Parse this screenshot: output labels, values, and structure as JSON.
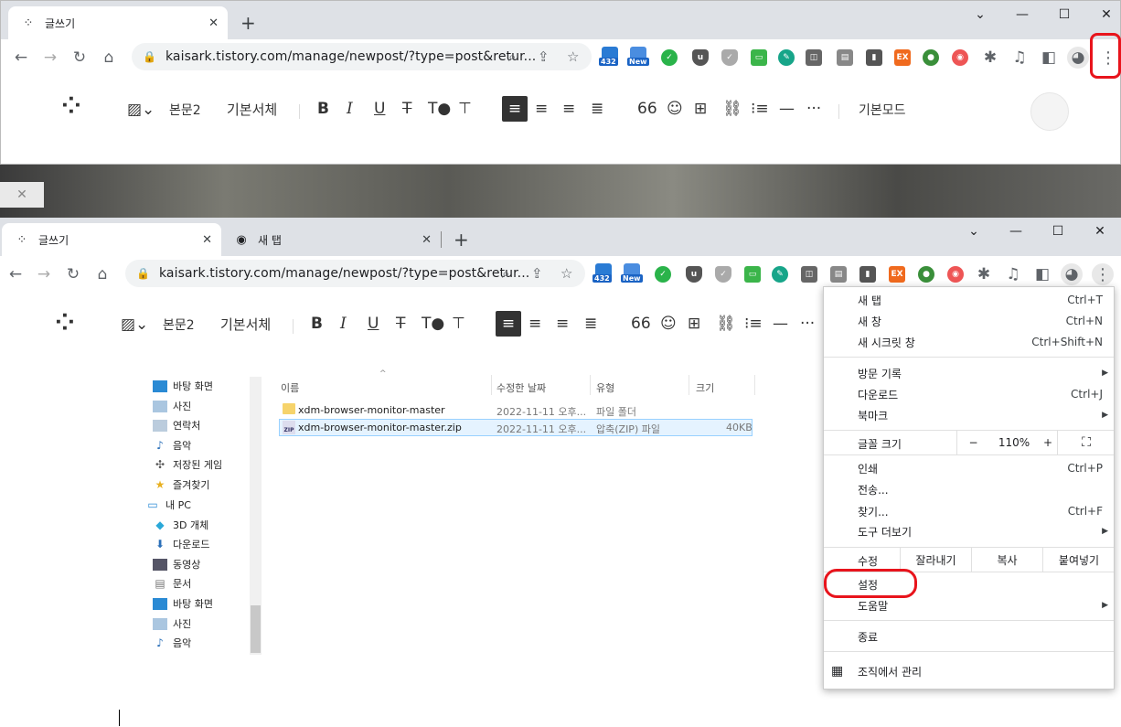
{
  "top_window": {
    "tab_title": "글쓰기",
    "url": "kaisark.tistory.com/manage/newpost/?type=post&retur..."
  },
  "bottom_window": {
    "tabs": [
      {
        "title": "글쓰기",
        "active": true
      },
      {
        "title": "새 탭",
        "active": false
      }
    ],
    "url": "kaisark.tistory.com/manage/newpost/?type=post&retur..."
  },
  "extensions": {
    "badge_count": "432",
    "badge_new": "New"
  },
  "editor": {
    "paragraph_style": "본문2",
    "font_style": "기본서체",
    "mode": "기본모드"
  },
  "context_menu": {
    "items_group1": [
      {
        "label": "새 탭",
        "shortcut": "Ctrl+T"
      },
      {
        "label": "새 창",
        "shortcut": "Ctrl+N"
      },
      {
        "label": "새 시크릿 창",
        "shortcut": "Ctrl+Shift+N"
      }
    ],
    "items_group2": [
      {
        "label": "방문 기록",
        "shortcut": ""
      },
      {
        "label": "다운로드",
        "shortcut": "Ctrl+J"
      },
      {
        "label": "북마크",
        "shortcut": ""
      }
    ],
    "zoom": {
      "label": "글꼴 크기",
      "minus": "−",
      "value": "110%",
      "plus": "+"
    },
    "items_group3": [
      {
        "label": "인쇄",
        "shortcut": "Ctrl+P"
      },
      {
        "label": "전송...",
        "shortcut": ""
      },
      {
        "label": "찾기...",
        "shortcut": "Ctrl+F"
      },
      {
        "label": "도구 더보기",
        "shortcut": ""
      }
    ],
    "edit": {
      "label": "수정",
      "cut": "잘라내기",
      "copy": "복사",
      "paste": "붙여넣기"
    },
    "settings": "설정",
    "help": "도움말",
    "exit": "종료",
    "managed": "조직에서 관리"
  },
  "file_explorer": {
    "columns": [
      "이름",
      "수정한 날짜",
      "유형",
      "크기"
    ],
    "files": [
      {
        "name": "xdm-browser-monitor-master",
        "date": "2022-11-11 오후...",
        "type": "파일 폴더",
        "size": ""
      },
      {
        "name": "xdm-browser-monitor-master.zip",
        "date": "2022-11-11 오후...",
        "type": "압축(ZIP) 파일",
        "size": "40KB"
      }
    ],
    "nav": [
      "바탕 화면",
      "사진",
      "연락처",
      "음악",
      "저장된 게임",
      "즐겨찾기",
      "내 PC",
      "3D 개체",
      "다운로드",
      "동영상",
      "문서",
      "바탕 화면",
      "사진",
      "음악"
    ]
  }
}
